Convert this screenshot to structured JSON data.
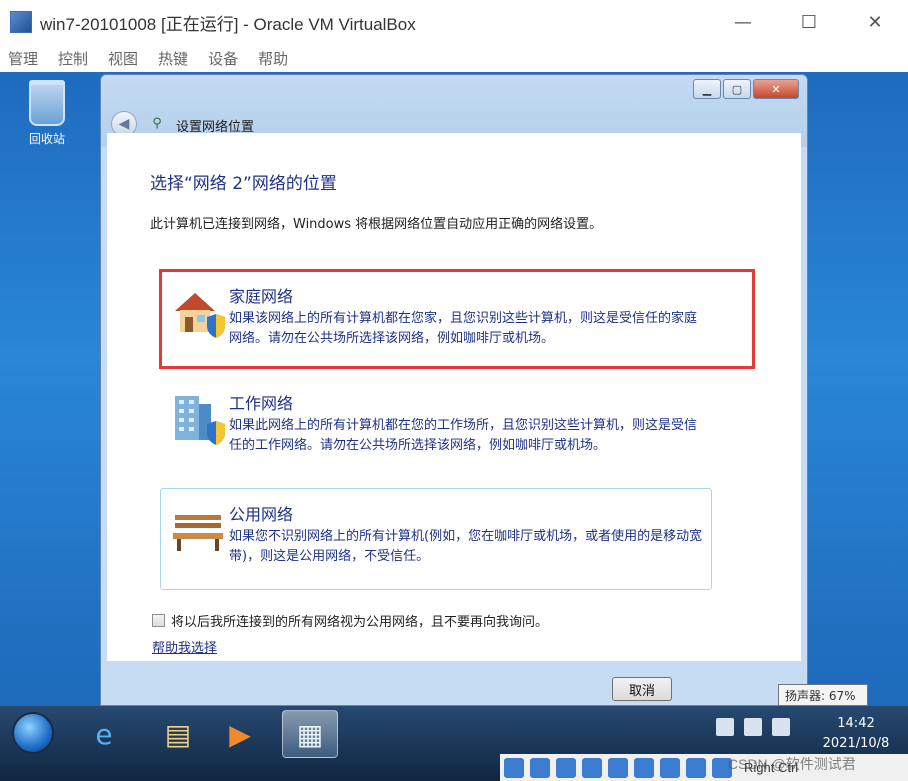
{
  "host": {
    "title": "win7-20101008 [正在运行] - Oracle VM VirtualBox",
    "menu": [
      "管理",
      "控制",
      "视图",
      "热键",
      "设备",
      "帮助"
    ],
    "status_host_key": "Right Ctrl"
  },
  "desktop": {
    "recycle_bin_label": "回收站"
  },
  "dialog": {
    "title": "设置网络位置",
    "heading": "选择“网络 2”网络的位置",
    "description": "此计算机已连接到网络，Windows 将根据网络位置自动应用正确的网络设置。",
    "options": [
      {
        "title": "家庭网络",
        "description": "如果该网络上的所有计算机都在您家，且您识别这些计算机，则这是受信任的家庭网络。请勿在公共场所选择该网络，例如咖啡厅或机场。",
        "icon": "home-network-icon"
      },
      {
        "title": "工作网络",
        "description": "如果此网络上的所有计算机都在您的工作场所，且您识别这些计算机，则这是受信任的工作网络。请勿在公共场所选择该网络，例如咖啡厅或机场。",
        "icon": "work-network-icon"
      },
      {
        "title": "公用网络",
        "description": "如果您不识别网络上的所有计算机(例如，您在咖啡厅或机场，或者使用的是移动宽带)，则这是公用网络，不受信任。",
        "icon": "public-network-icon"
      }
    ],
    "checkbox_label": "将以后我所连接到的所有网络视为公用网络，且不要再向我询问。",
    "help_link": "帮助我选择",
    "cancel_label": "取消"
  },
  "tooltip": "扬声器: 67%",
  "clock": {
    "time": "14:42",
    "date": "2021/10/8"
  },
  "watermark": "CSDN @软件测试君",
  "colors": {
    "highlight": "#e53935",
    "link": "#1e3287",
    "desktop": "#2a86d6"
  }
}
